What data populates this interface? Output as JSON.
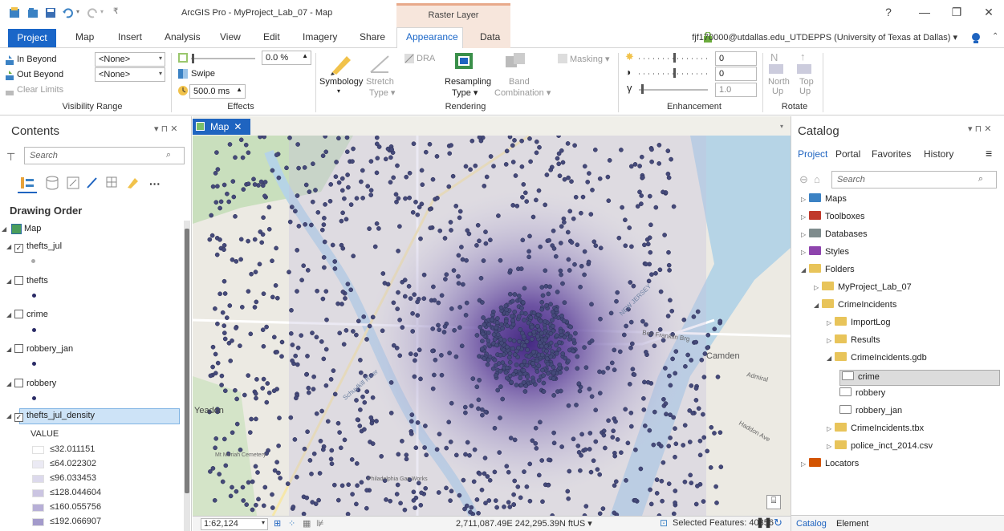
{
  "titlebar": {
    "title": "ArcGIS Pro - MyProject_Lab_07 - Map",
    "contextual_tab": "Raster Layer",
    "help": "?",
    "minimize": "—",
    "restore": "❐",
    "close": "✕"
  },
  "ribbon_tabs": {
    "project": "Project",
    "items": [
      "Map",
      "Insert",
      "Analysis",
      "View",
      "Edit",
      "Imagery",
      "Share",
      "Appearance",
      "Data"
    ],
    "active": "Appearance",
    "account": "fjf170000@utdallas.edu_UTDEPPS (University of Texas at Dallas) ▾"
  },
  "ribbon": {
    "visibility": {
      "in_beyond": "In Beyond",
      "out_beyond": "Out Beyond",
      "clear_limits": "Clear Limits",
      "in_value": "<None>",
      "out_value": "<None>",
      "label": "Visibility Range"
    },
    "effects": {
      "transparency": "0.0 %",
      "swipe": "Swipe",
      "flicker": "500.0 ms",
      "label": "Effects"
    },
    "rendering": {
      "dra": "DRA",
      "symbology": "Symbology",
      "stretch_type": "Stretch",
      "stretch_type2": "Type ▾",
      "resampling": "Resampling",
      "resampling2": "Type ▾",
      "band": "Band",
      "band2": "Combination ▾",
      "masking": "Masking ▾",
      "label": "Rendering"
    },
    "enhancement": {
      "brightness": "0",
      "contrast": "0",
      "gamma": "1.0",
      "label": "Enhancement"
    },
    "rotate": {
      "north": "North",
      "north2": "Up",
      "top": "Top",
      "top2": "Up",
      "label": "Rotate"
    }
  },
  "contents": {
    "title": "Contents",
    "search_placeholder": "Search",
    "drawing_order": "Drawing Order",
    "map_label": "Map",
    "layers": [
      {
        "name": "thefts_jul",
        "checked": true
      },
      {
        "name": "thefts",
        "checked": false
      },
      {
        "name": "crime",
        "checked": false
      },
      {
        "name": "robbery_jan",
        "checked": false
      },
      {
        "name": "robbery",
        "checked": false
      },
      {
        "name": "thefts_jul_density",
        "checked": true
      }
    ],
    "legend_title": "VALUE",
    "legend": [
      {
        "label": "≤32.011151",
        "color": "#ffffff"
      },
      {
        "label": "≤64.022302",
        "color": "#ebeaf4"
      },
      {
        "label": "≤96.033453",
        "color": "#dcd9ec"
      },
      {
        "label": "≤128.044604",
        "color": "#cbc5e2"
      },
      {
        "label": "≤160.055756",
        "color": "#b7afd7"
      },
      {
        "label": "≤192.066907",
        "color": "#a39acb"
      }
    ]
  },
  "map": {
    "tab": "Map",
    "labels": {
      "camden": "Camden",
      "yeadon": "Yeadon",
      "franklin": "Ben Franklin Brg",
      "new_jersey": "NEW JERSEY",
      "admiral": "Admiral",
      "haddon": "Haddon Ave",
      "philadelphia_gas": "Philadelphia Gas Works",
      "mt_moriah": "Mt Moriah Cemetery",
      "schuylkill": "Schuylkill River"
    },
    "status": {
      "scale": "1:62,124",
      "coords": "2,711,087.49E 242,295.39N ftUS ▾",
      "selected": "Selected Features: 40356"
    }
  },
  "catalog": {
    "title": "Catalog",
    "tabs": [
      "Project",
      "Portal",
      "Favorites",
      "History"
    ],
    "search_placeholder": "Search",
    "tree": [
      {
        "label": "Maps",
        "level": 0
      },
      {
        "label": "Toolboxes",
        "level": 0
      },
      {
        "label": "Databases",
        "level": 0
      },
      {
        "label": "Styles",
        "level": 0
      },
      {
        "label": "Folders",
        "level": 0
      },
      {
        "label": "MyProject_Lab_07",
        "level": 1
      },
      {
        "label": "CrimeIncidents",
        "level": 1
      },
      {
        "label": "ImportLog",
        "level": 2
      },
      {
        "label": "Results",
        "level": 2
      },
      {
        "label": "CrimeIncidents.gdb",
        "level": 2
      },
      {
        "label": "crime",
        "level": 3,
        "selected": true
      },
      {
        "label": "robbery",
        "level": 3
      },
      {
        "label": "robbery_jan",
        "level": 3
      },
      {
        "label": "CrimeIncidents.tbx",
        "level": 2
      },
      {
        "label": "police_inct_2014.csv",
        "level": 2
      },
      {
        "label": "Locators",
        "level": 0
      }
    ],
    "bottom_tabs": [
      "Catalog",
      "Element"
    ]
  }
}
